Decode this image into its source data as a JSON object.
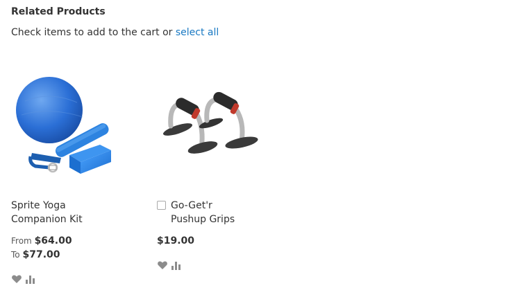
{
  "block": {
    "title": "Related Products",
    "instruction": "Check items to add to the cart or",
    "select_all": "select all"
  },
  "products": [
    {
      "name": "Sprite Yoga Companion Kit",
      "price_from_label": "From",
      "price_from": "$64.00",
      "price_to_label": "To",
      "price_to": "$77.00",
      "image_icon": "yoga-kit-icon",
      "has_checkbox": false
    },
    {
      "name": "Go-Get'r Pushup Grips",
      "price": "$19.00",
      "image_icon": "pushup-grips-icon",
      "has_checkbox": true
    }
  ],
  "actions": {
    "wishlist_icon": "heart-icon",
    "compare_icon": "bar-chart-icon"
  },
  "colors": {
    "link": "#1979c3",
    "text": "#333333",
    "icon": "#8c8c8c"
  }
}
